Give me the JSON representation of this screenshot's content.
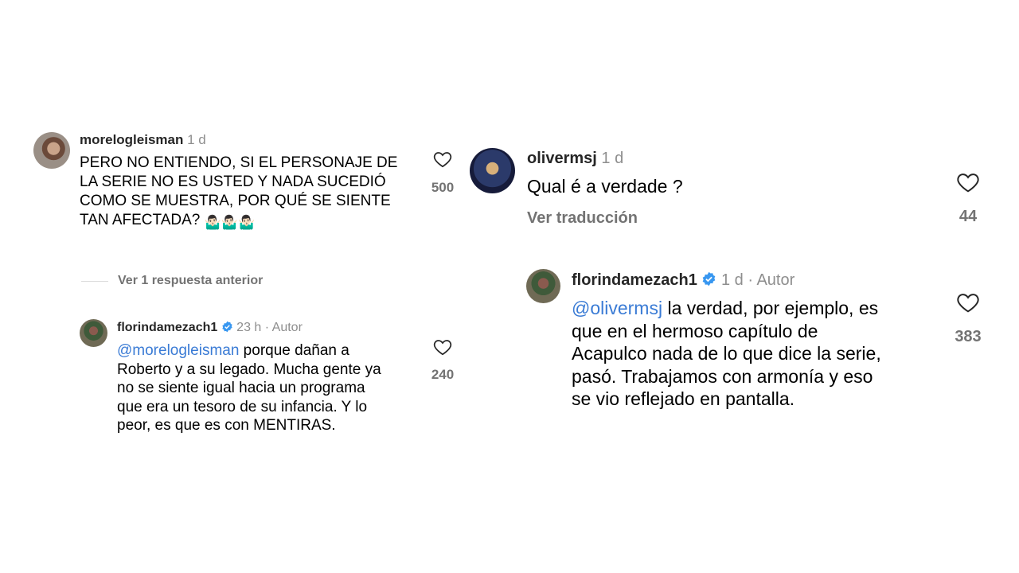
{
  "left": {
    "comment": {
      "username": "morelogleisman",
      "time": "1 d",
      "text_lines": [
        "PERO NO ENTIENDO, SI EL PERSONAJE DE",
        "LA SERIE NO ES USTED Y NADA SUCEDIÓ",
        "COMO SE MUESTRA, POR QUÉ SE SIENTE",
        "TAN AFECTADA?"
      ],
      "emoji": "🤷🏻‍♂️🤷🏻‍♂️🤷🏻‍♂️",
      "likes": "500"
    },
    "view_replies": "Ver 1 respuesta anterior",
    "reply": {
      "username": "florindamezach1",
      "time": "23 h",
      "author": "Autor",
      "mention": "@morelogleisman",
      "text_lines": [
        " porque dañan a",
        "Roberto y a su legado. Mucha gente ya",
        "no se siente igual hacia un programa",
        "que era un tesoro de su infancia. Y lo",
        "peor, es que es con MENTIRAS."
      ],
      "likes": "240"
    }
  },
  "right": {
    "comment": {
      "username": "olivermsj",
      "time": "1 d",
      "text": "Qual é a verdade ?",
      "translate": "Ver traducción",
      "likes": "44"
    },
    "reply": {
      "username": "florindamezach1",
      "time": "1 d",
      "author": "Autor",
      "mention": "@olivermsj",
      "text_lines": [
        " la verdad, por ejemplo, es",
        "que en el hermoso capítulo de",
        "Acapulco nada de lo que dice la serie,",
        "pasó. Trabajamos con armonía y eso",
        "se vio reflejado en pantalla."
      ],
      "likes": "383"
    }
  },
  "colors": {
    "verified": "#3897f0",
    "mention": "#3a7bd5",
    "muted": "#737373"
  }
}
